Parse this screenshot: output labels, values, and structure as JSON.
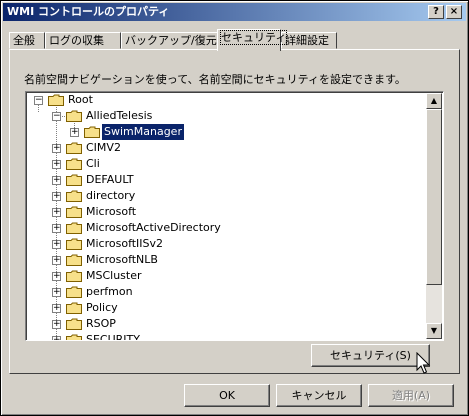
{
  "window": {
    "title": "WMI コントロールのプロパティ",
    "help_button": "?",
    "close_button": "×"
  },
  "tabs": [
    {
      "label": "全般"
    },
    {
      "label": "ログの収集"
    },
    {
      "label": "バックアップ/復元"
    },
    {
      "label": "セキュリティ",
      "active": true
    },
    {
      "label": "詳細設定"
    }
  ],
  "security": {
    "description": "名前空間ナビゲーションを使って、名前空間にセキュリティを設定できます。",
    "tree": {
      "root": "Root",
      "alliedtelesis": "AlliedTelesis",
      "swimmanager": "SwimManager",
      "items": [
        "CIMV2",
        "Cli",
        "DEFAULT",
        "directory",
        "Microsoft",
        "MicrosoftActiveDirectory",
        "MicrosoftIISv2",
        "MicrosoftNLB",
        "MSCluster",
        "perfmon",
        "Policy",
        "RSOP",
        "SECURITY"
      ],
      "selected": "SwimManager"
    },
    "security_button": "セキュリティ(S)"
  },
  "footer": {
    "ok": "OK",
    "cancel": "キャンセル",
    "apply": "適用(A)"
  },
  "colors": {
    "title_start": "#0a246a",
    "title_end": "#a6caf0",
    "face": "#d4d0c8",
    "folder": "#f7e08a",
    "selection": "#0a246a"
  }
}
